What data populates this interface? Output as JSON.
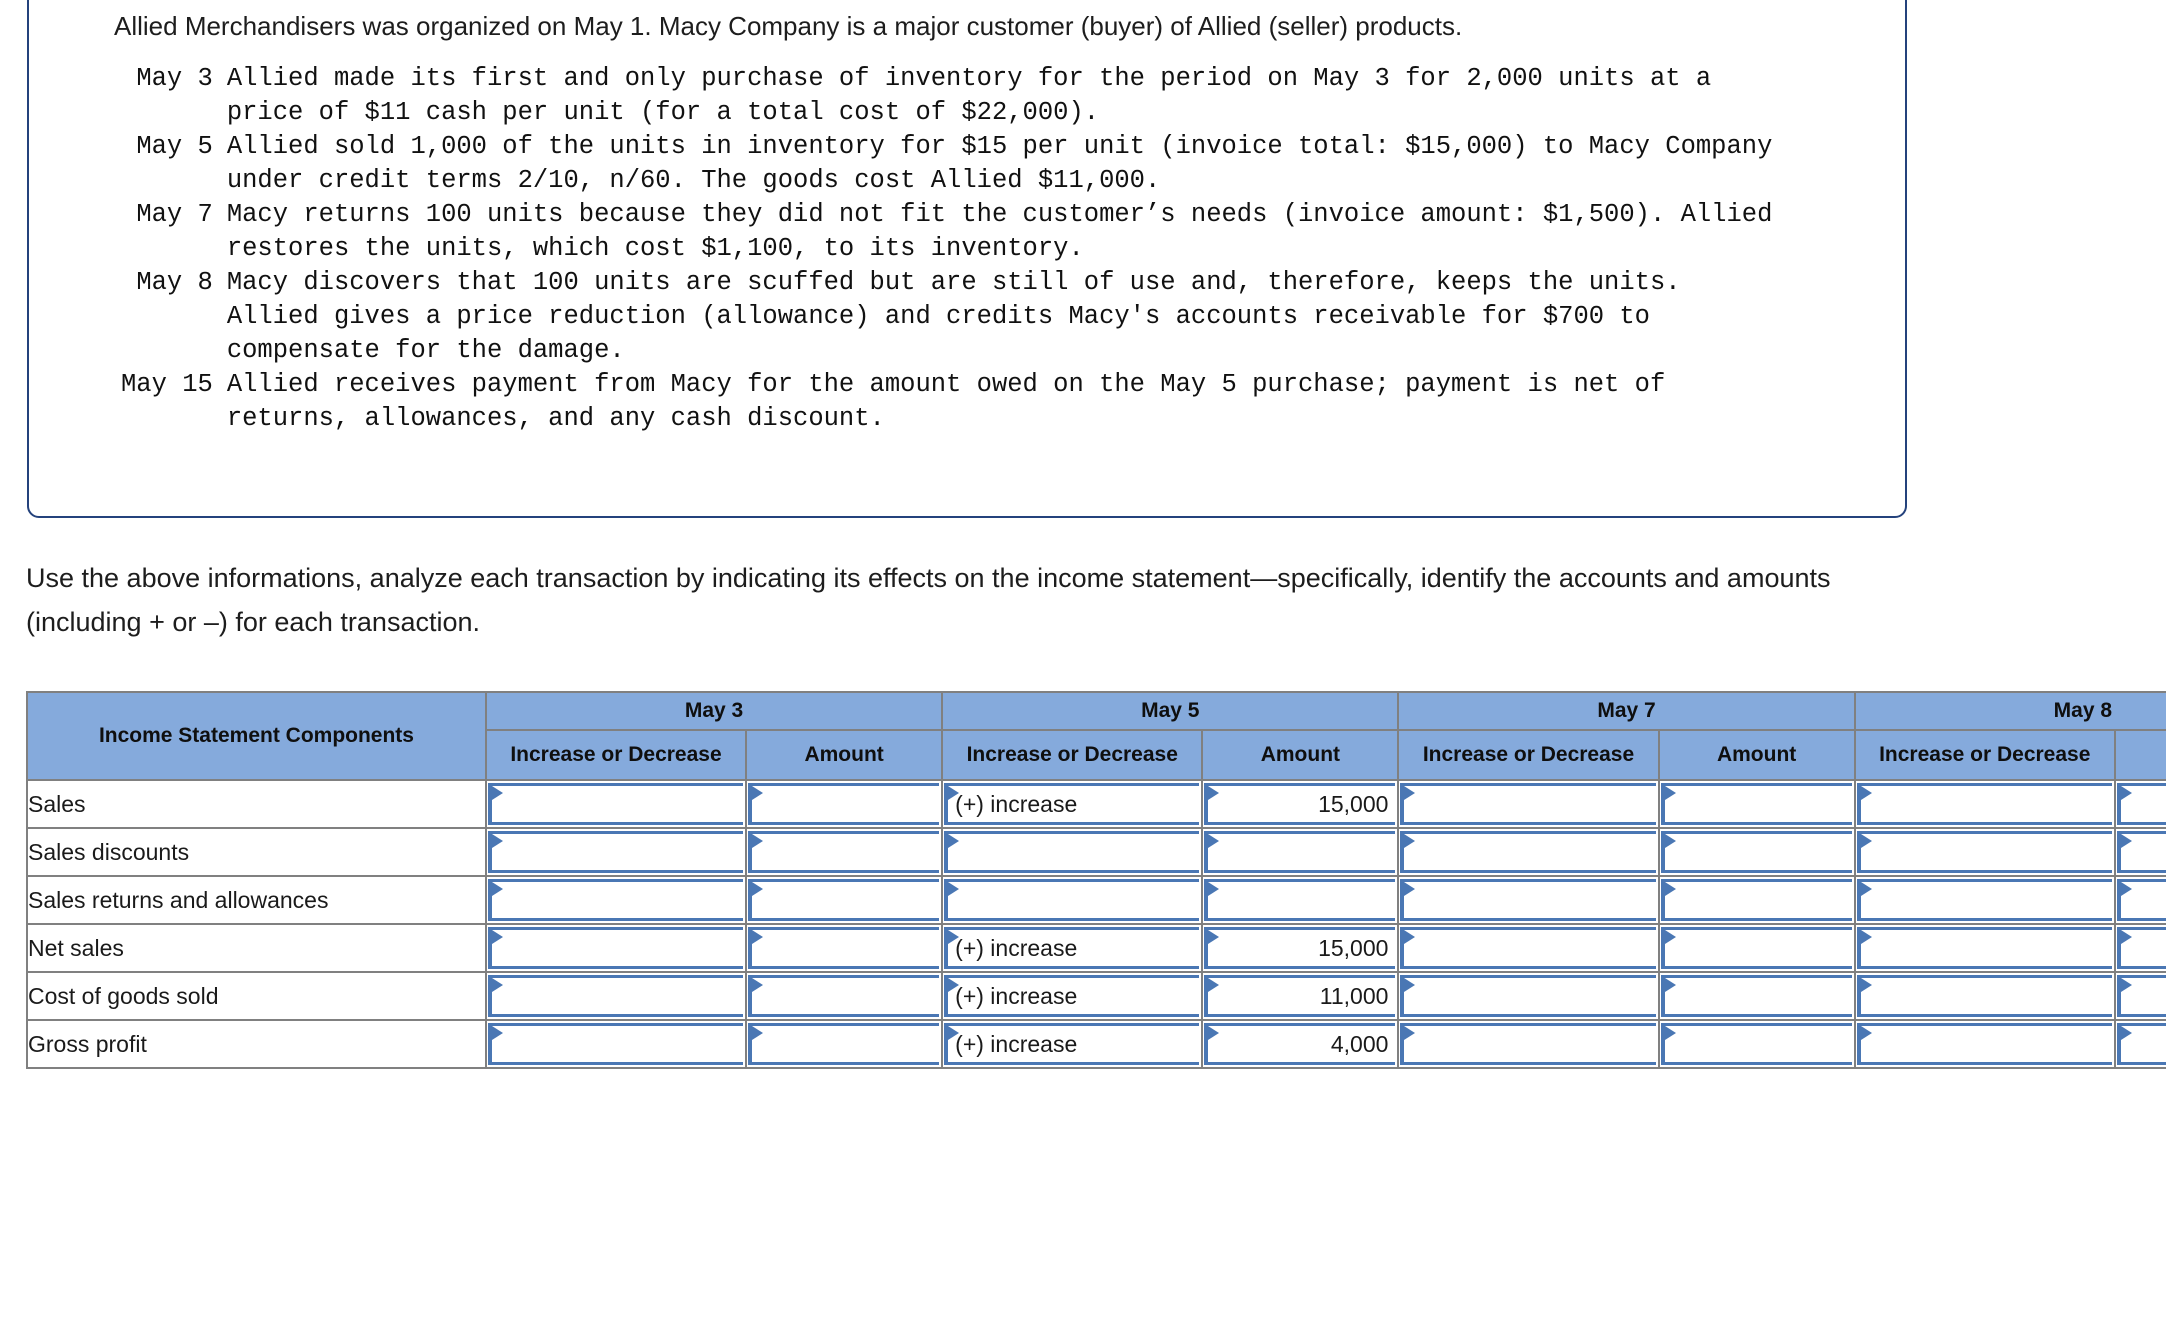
{
  "scenario": {
    "intro": "Allied Merchandisers was organized on May 1. Macy Company is a major customer (buyer) of Allied (seller) products.",
    "events": [
      {
        "date": "May 3",
        "description": "Allied made its first and only purchase of inventory for the period on May 3 for 2,000 units at a\nprice of $11 cash per unit (for a total cost of $22,000)."
      },
      {
        "date": "May 5",
        "description": "Allied sold 1,000 of the units in inventory for $15 per unit (invoice total: $15,000) to Macy Company\nunder credit terms 2/10, n/60. The goods cost Allied $11,000."
      },
      {
        "date": "May 7",
        "description": "Macy returns 100 units because they did not fit the customer’s needs (invoice amount: $1,500). Allied\nrestores the units, which cost $1,100, to its inventory."
      },
      {
        "date": "May 8",
        "description": "Macy discovers that 100 units are scuffed but are still of use and, therefore, keeps the units.\nAllied gives a price reduction (allowance) and credits Macy's accounts receivable for $700 to\ncompensate for the damage."
      },
      {
        "date": "May 15",
        "description": "Allied receives payment from Macy for the amount owed on the May 5 purchase; payment is net of\nreturns, allowances, and any cash discount."
      }
    ]
  },
  "instructions": {
    "text": "Use the above informations, analyze each transaction by indicating its effects on the income statement—specifically, identify the accounts and amounts (including + or –) for each transaction."
  },
  "answer_table": {
    "row_label_header": "Income Statement Components",
    "date_groups": [
      "May 3",
      "May 5",
      "May 7",
      "May 8"
    ],
    "sub_headers": {
      "direction": "Increase or Decrease",
      "amount": "Amount"
    },
    "rows": [
      {
        "label": "Sales",
        "cells": [
          {
            "direction": "",
            "amount": ""
          },
          {
            "direction": "(+) increase",
            "amount": "15,000"
          },
          {
            "direction": "",
            "amount": ""
          },
          {
            "direction": "",
            "amount": ""
          }
        ]
      },
      {
        "label": "Sales discounts",
        "cells": [
          {
            "direction": "",
            "amount": ""
          },
          {
            "direction": "",
            "amount": ""
          },
          {
            "direction": "",
            "amount": ""
          },
          {
            "direction": "",
            "amount": ""
          }
        ]
      },
      {
        "label": "Sales returns and allowances",
        "cells": [
          {
            "direction": "",
            "amount": ""
          },
          {
            "direction": "",
            "amount": ""
          },
          {
            "direction": "",
            "amount": ""
          },
          {
            "direction": "",
            "amount": ""
          }
        ]
      },
      {
        "label": "Net sales",
        "cells": [
          {
            "direction": "",
            "amount": ""
          },
          {
            "direction": "(+) increase",
            "amount": "15,000"
          },
          {
            "direction": "",
            "amount": ""
          },
          {
            "direction": "",
            "amount": ""
          }
        ]
      },
      {
        "label": "Cost of goods sold",
        "cells": [
          {
            "direction": "",
            "amount": ""
          },
          {
            "direction": "(+) increase",
            "amount": "11,000"
          },
          {
            "direction": "",
            "amount": ""
          },
          {
            "direction": "",
            "amount": ""
          }
        ]
      },
      {
        "label": "Gross profit",
        "cells": [
          {
            "direction": "",
            "amount": ""
          },
          {
            "direction": "(+) increase",
            "amount": "4,000"
          },
          {
            "direction": "",
            "amount": ""
          },
          {
            "direction": "",
            "amount": ""
          }
        ]
      }
    ]
  },
  "colors": {
    "header_blue": "#85aadc",
    "cell_border_blue": "#4a77b4",
    "box_border": "#24427c",
    "grid_gray": "#808080"
  }
}
